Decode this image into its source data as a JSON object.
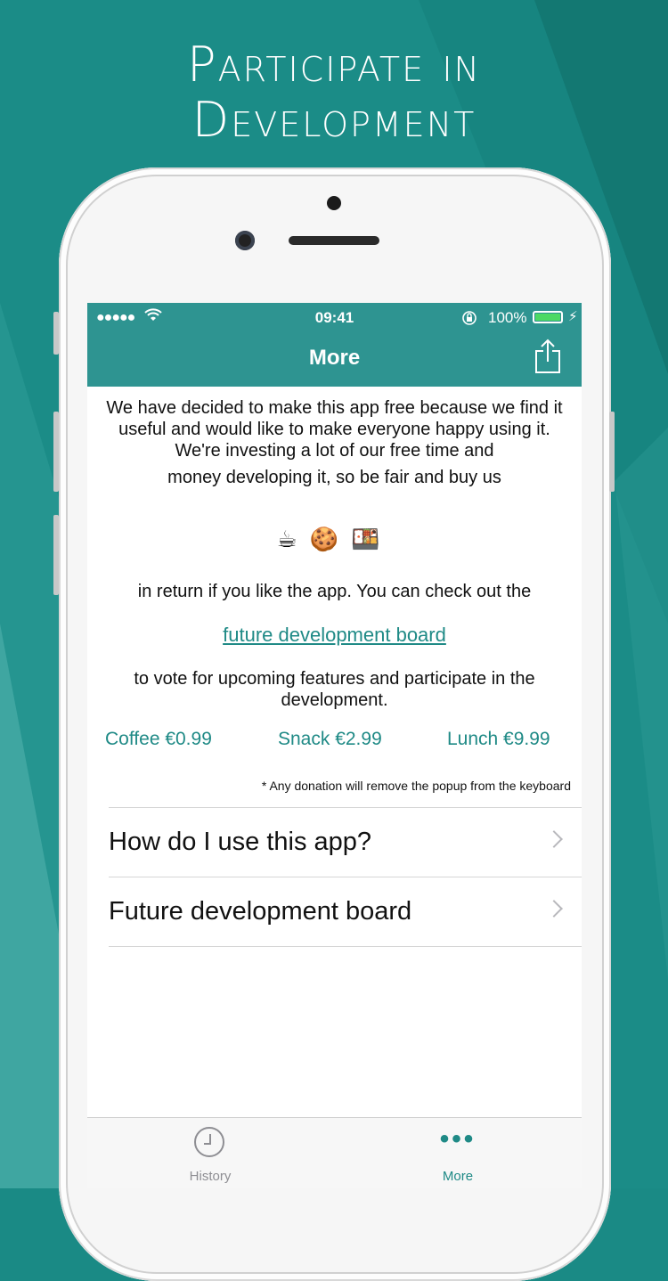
{
  "headline": {
    "line1": "Participate in",
    "line2": "Development"
  },
  "status_bar": {
    "signal": "●●●●●",
    "time": "09:41",
    "battery": "100%"
  },
  "nav": {
    "title": "More",
    "share_icon": "share-icon"
  },
  "content": {
    "paragraph1": "We have decided to make this app free because we find it useful and would like to make everyone happy using it. We're investing a lot of our free time and",
    "paragraph1b": "money developing it, so be fair and buy us",
    "emojis": "☕🍪🍱",
    "paragraph2": "in return if you like the app. You can check out the",
    "link": "future development board",
    "paragraph3": "to vote for upcoming features and participate in the development.",
    "donations": [
      {
        "label": "Coffee €0.99"
      },
      {
        "label": "Snack €2.99"
      },
      {
        "label": "Lunch €9.99"
      }
    ],
    "note": "* Any donation will remove the popup from the keyboard"
  },
  "list": [
    {
      "label": "How do I use this app?"
    },
    {
      "label": "Future development board"
    }
  ],
  "tabbar": [
    {
      "label": "History",
      "icon": "clock-icon"
    },
    {
      "label": "More",
      "icon": "more-dots-icon"
    }
  ],
  "colors": {
    "accent": "#2e9491",
    "link": "#1f8a86",
    "background": "#1a8a85"
  }
}
